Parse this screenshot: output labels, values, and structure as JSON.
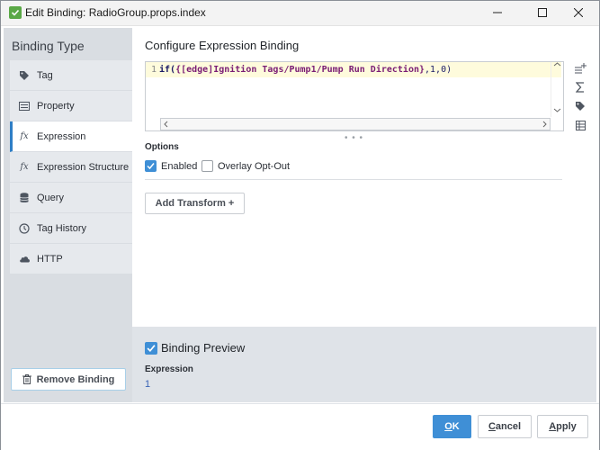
{
  "window": {
    "title": "Edit Binding: RadioGroup.props.index",
    "app_icon": "check-icon",
    "controls": [
      "minimize-icon",
      "maximize-icon",
      "close-icon"
    ]
  },
  "sidebar": {
    "heading": "Binding Type",
    "items": [
      {
        "label": "Tag",
        "icon": "tag-icon",
        "selected": false
      },
      {
        "label": "Property",
        "icon": "list-icon",
        "selected": false
      },
      {
        "label": "Expression",
        "icon": "fx-icon",
        "selected": true
      },
      {
        "label": "Expression Structure",
        "icon": "fx-icon",
        "selected": false
      },
      {
        "label": "Query",
        "icon": "database-icon",
        "selected": false
      },
      {
        "label": "Tag History",
        "icon": "clock-icon",
        "selected": false
      },
      {
        "label": "HTTP",
        "icon": "cloud-icon",
        "selected": false
      }
    ],
    "fx_glyph": "fx",
    "remove_button": "Remove Binding"
  },
  "config": {
    "title": "Configure Expression Binding",
    "editor": {
      "line_number": "1",
      "code_prefix": "if(",
      "code_tag": "{[edge]Ignition Tags/Pump1/Pump Run Direction}",
      "code_suffix": ",1,0)"
    },
    "side_tools": [
      "add-line-icon",
      "sigma-icon",
      "tag-icon",
      "table-icon"
    ],
    "drag_handle": "• • •",
    "options_label": "Options",
    "enabled_label": "Enabled",
    "enabled_checked": true,
    "overlay_label": "Overlay Opt-Out",
    "overlay_checked": false,
    "add_transform": "Add Transform +"
  },
  "preview": {
    "title": "Binding Preview",
    "checked": true,
    "expression_label": "Expression",
    "expression_value": "1"
  },
  "footer": {
    "ok": "OK",
    "cancel": "Cancel",
    "apply": "Apply"
  },
  "colors": {
    "accent": "#3f8fd6",
    "selected_border": "#2e7ec6",
    "editor_line_bg": "#fefbdc",
    "panel_bg": "#d9dde2"
  }
}
